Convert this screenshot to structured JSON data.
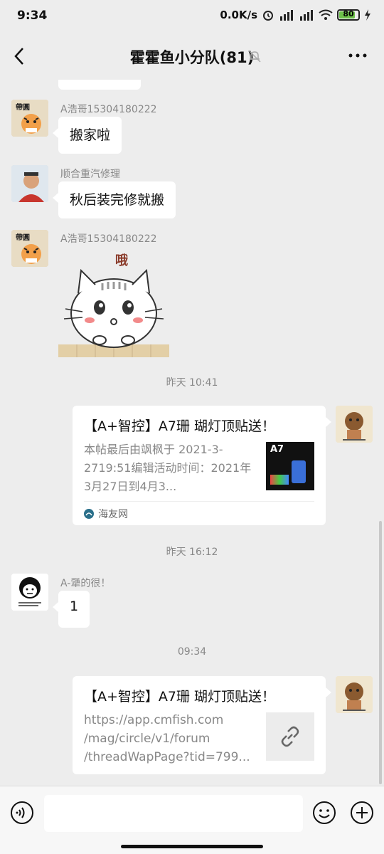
{
  "status_bar": {
    "time": "9:34",
    "speed": "0.0K/s",
    "battery": "80"
  },
  "nav": {
    "title": "霍霍鱼小分队(81)"
  },
  "messages": [
    {
      "sender": "A浩哥15304180222",
      "text": "搬家啦"
    },
    {
      "sender": "顺合重汽修理",
      "text": "秋后装完修就搬"
    },
    {
      "sender": "A浩哥15304180222",
      "sticker_text": "哦"
    },
    {
      "timestamp": "昨天 10:41"
    },
    {
      "card_title": "【A+智控】A7珊 瑚灯顶贴送！",
      "card_desc": "本帖最后由飒枫于 2021-3-2719:51编辑活动时间：2021年3月27日到4月3...",
      "card_source": "海友网",
      "thumb_text": "A7"
    },
    {
      "timestamp": "昨天 16:12"
    },
    {
      "sender": "A-犟的很！",
      "text": "1"
    },
    {
      "timestamp": "09:34"
    },
    {
      "card_title": "【A+智控】A7珊 瑚灯顶贴送！",
      "card_desc": "https://app.cmfish.com /mag/circle/v1/forum /threadWapPage?tid=799..."
    }
  ],
  "colors": {
    "background": "#ededed",
    "bubble": "#ffffff",
    "muted_text": "#888888"
  }
}
